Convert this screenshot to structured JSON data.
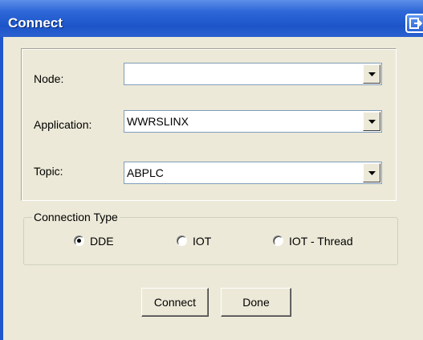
{
  "window": {
    "title": "Connect"
  },
  "form": {
    "node": {
      "label": "Node:",
      "value": ""
    },
    "application": {
      "label": "Application:",
      "value": "WWRSLINX"
    },
    "topic": {
      "label": "Topic:",
      "value": "ABPLC"
    }
  },
  "connection_type": {
    "legend": "Connection Type",
    "options": [
      {
        "label": "DDE",
        "selected": true
      },
      {
        "label": "IOT",
        "selected": false
      },
      {
        "label": "IOT - Thread",
        "selected": false
      }
    ]
  },
  "buttons": {
    "connect": "Connect",
    "done": "Done"
  },
  "colors": {
    "titlebar": "#1d55c9",
    "dialog_bg": "#ece9d8"
  }
}
